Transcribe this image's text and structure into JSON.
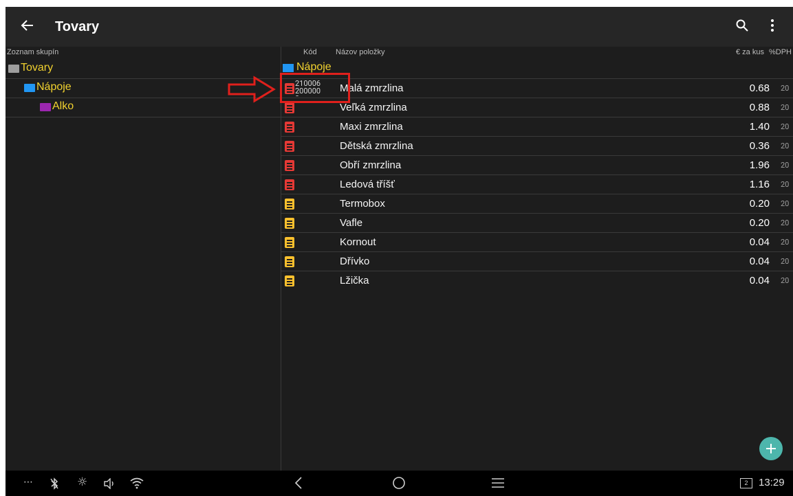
{
  "appbar": {
    "title": "Tovary"
  },
  "left_panel": {
    "header": "Zoznam skupín",
    "groups": [
      {
        "label": "Tovary",
        "color": "#f2d22f",
        "folder_color": "#9e9e9e"
      },
      {
        "label": "Nápoje",
        "color": "#f2d22f",
        "folder_color": "#2196f3"
      },
      {
        "label": "Alko",
        "color": "#f2d22f",
        "folder_color": "#9c27b0"
      }
    ]
  },
  "right_panel": {
    "headers": {
      "code": "Kód",
      "name": "Názov položky",
      "price": "€ za kus",
      "vat": "%DPH"
    },
    "parent_group": "Nápoje",
    "items": [
      {
        "code": "2100062000000",
        "name": "Malá zmrzlina",
        "price": "0.68",
        "vat": "20",
        "icon_color": "#e53935"
      },
      {
        "code": "",
        "name": "Veľká zmrzlina",
        "price": "0.88",
        "vat": "20",
        "icon_color": "#e53935"
      },
      {
        "code": "",
        "name": "Maxi zmrzlina",
        "price": "1.40",
        "vat": "20",
        "icon_color": "#e53935"
      },
      {
        "code": "",
        "name": "Dětská zmrzlina",
        "price": "0.36",
        "vat": "20",
        "icon_color": "#e53935"
      },
      {
        "code": "",
        "name": "Obří zmrzlina",
        "price": "1.96",
        "vat": "20",
        "icon_color": "#e53935"
      },
      {
        "code": "",
        "name": "Ledová tříšť",
        "price": "1.16",
        "vat": "20",
        "icon_color": "#e53935"
      },
      {
        "code": "",
        "name": "Termobox",
        "price": "0.20",
        "vat": "20",
        "icon_color": "#fbc02d"
      },
      {
        "code": "",
        "name": "Vafle",
        "price": "0.20",
        "vat": "20",
        "icon_color": "#fbc02d"
      },
      {
        "code": "",
        "name": "Kornout",
        "price": "0.04",
        "vat": "20",
        "icon_color": "#fbc02d"
      },
      {
        "code": "",
        "name": "Dřívko",
        "price": "0.04",
        "vat": "20",
        "icon_color": "#fbc02d"
      },
      {
        "code": "",
        "name": "Lžička",
        "price": "0.04",
        "vat": "20",
        "icon_color": "#fbc02d"
      }
    ]
  },
  "navbar": {
    "time": "13:29",
    "badge": "2"
  }
}
